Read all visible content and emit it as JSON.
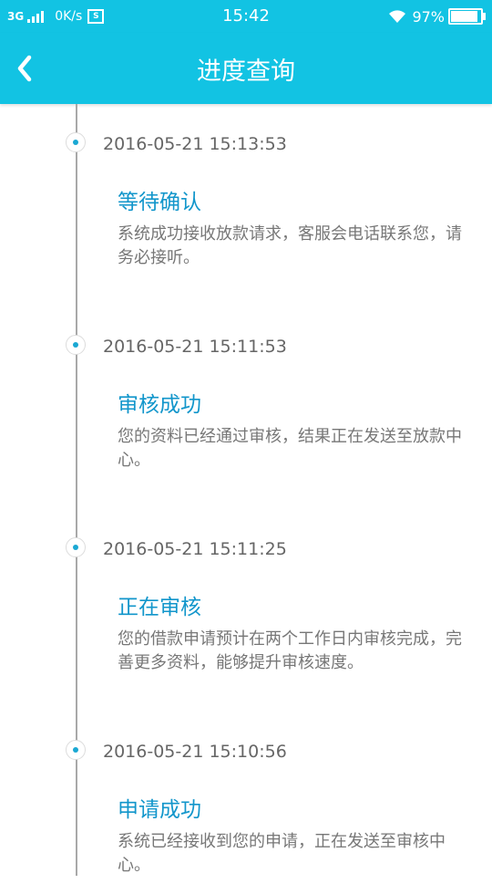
{
  "status_bar": {
    "network": "3G",
    "speed": "0K/s",
    "box_icon_text": "S",
    "time": "15:42",
    "battery_percent": "97%",
    "battery_level": 0.97
  },
  "toolbar": {
    "title": "进度查询"
  },
  "entries": [
    {
      "time": "2016-05-21 15:13:53",
      "status": "等待确认",
      "desc": "系统成功接收放款请求，客服会电话联系您，请务必接听。"
    },
    {
      "time": "2016-05-21 15:11:53",
      "status": "审核成功",
      "desc": "您的资料已经通过审核，结果正在发送至放款中心。"
    },
    {
      "time": "2016-05-21 15:11:25",
      "status": "正在审核",
      "desc": "您的借款申请预计在两个工作日内审核完成，完善更多资料，能够提升审核速度。"
    },
    {
      "time": "2016-05-21 15:10:56",
      "status": "申请成功",
      "desc": "系统已经接收到您的申请，正在发送至审核中心。"
    }
  ],
  "colors": {
    "accent": "#12c3e3",
    "status_text": "#1296cb",
    "dot": "#1aa8d3"
  }
}
